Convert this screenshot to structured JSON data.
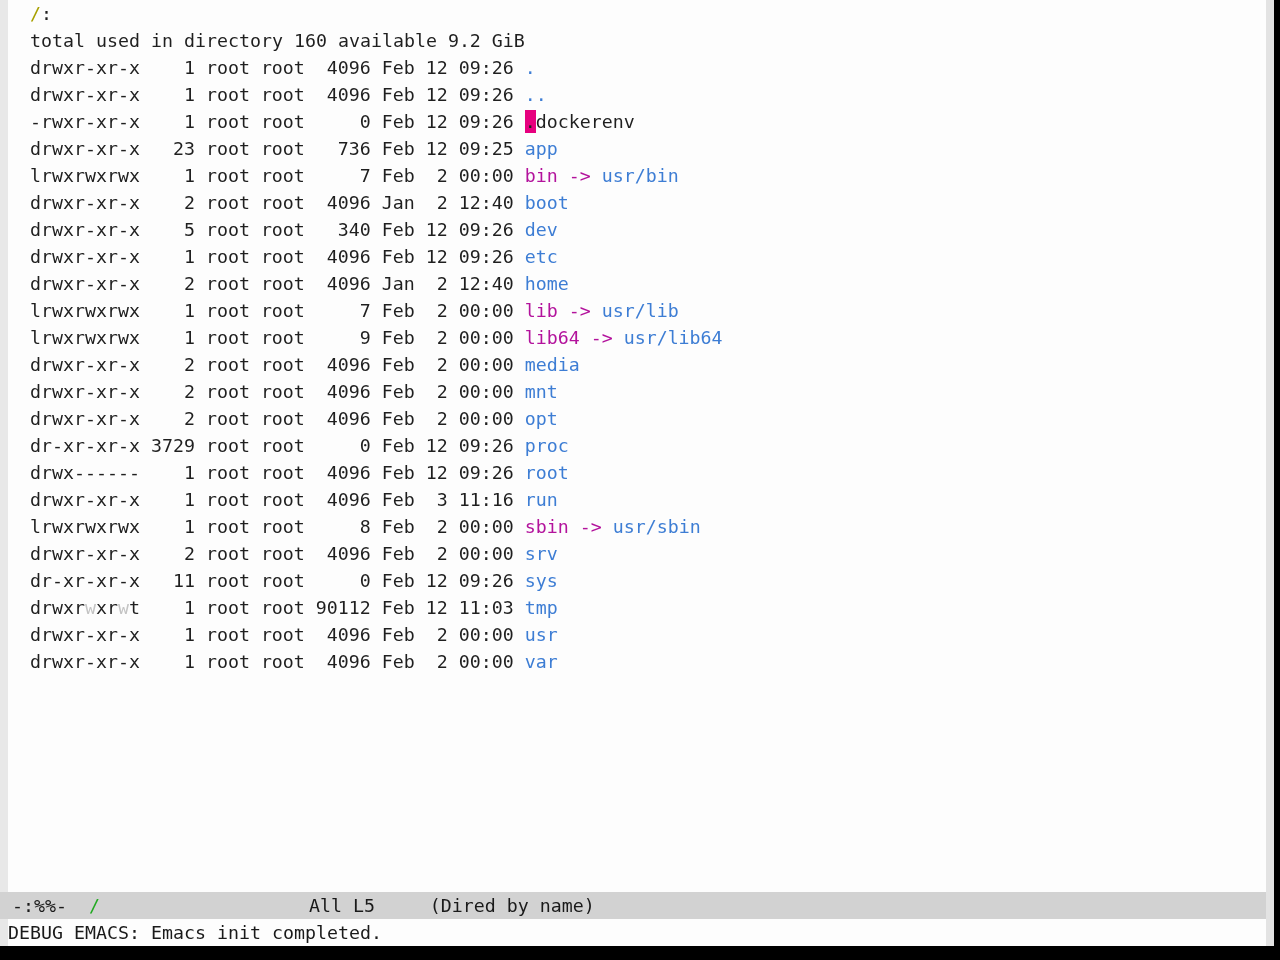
{
  "heading": {
    "path": "/",
    "suffix": ":"
  },
  "summary": "total used in directory 160 available 9.2 GiB",
  "entries": [
    {
      "permissions": [
        {
          "text": "drwxr-xr-x",
          "dim": false
        }
      ],
      "links": "1",
      "owner": "root",
      "group": "root",
      "size": "4096",
      "month": "Feb",
      "day": "12",
      "time": "09:26",
      "name": ".",
      "kind": "directory",
      "cursor": false
    },
    {
      "permissions": [
        {
          "text": "drwxr-xr-x",
          "dim": false
        }
      ],
      "links": "1",
      "owner": "root",
      "group": "root",
      "size": "4096",
      "month": "Feb",
      "day": "12",
      "time": "09:26",
      "name": "..",
      "kind": "directory",
      "cursor": false
    },
    {
      "permissions": [
        {
          "text": "-rwxr-xr-x",
          "dim": false
        }
      ],
      "links": "1",
      "owner": "root",
      "group": "root",
      "size": "0",
      "month": "Feb",
      "day": "12",
      "time": "09:26",
      "name": ".dockerenv",
      "kind": "file",
      "cursor": true
    },
    {
      "permissions": [
        {
          "text": "drwxr-xr-x",
          "dim": false
        }
      ],
      "links": "23",
      "owner": "root",
      "group": "root",
      "size": "736",
      "month": "Feb",
      "day": "12",
      "time": "09:25",
      "name": "app",
      "kind": "directory",
      "cursor": false
    },
    {
      "permissions": [
        {
          "text": "lrwxrwxrwx",
          "dim": false
        }
      ],
      "links": "1",
      "owner": "root",
      "group": "root",
      "size": "7",
      "month": "Feb",
      "day": "2",
      "time": "00:00",
      "name": "bin",
      "kind": "symlink",
      "arrow": "->",
      "target": "usr/bin",
      "cursor": false
    },
    {
      "permissions": [
        {
          "text": "drwxr-xr-x",
          "dim": false
        }
      ],
      "links": "2",
      "owner": "root",
      "group": "root",
      "size": "4096",
      "month": "Jan",
      "day": "2",
      "time": "12:40",
      "name": "boot",
      "kind": "directory",
      "cursor": false
    },
    {
      "permissions": [
        {
          "text": "drwxr-xr-x",
          "dim": false
        }
      ],
      "links": "5",
      "owner": "root",
      "group": "root",
      "size": "340",
      "month": "Feb",
      "day": "12",
      "time": "09:26",
      "name": "dev",
      "kind": "directory",
      "cursor": false
    },
    {
      "permissions": [
        {
          "text": "drwxr-xr-x",
          "dim": false
        }
      ],
      "links": "1",
      "owner": "root",
      "group": "root",
      "size": "4096",
      "month": "Feb",
      "day": "12",
      "time": "09:26",
      "name": "etc",
      "kind": "directory",
      "cursor": false
    },
    {
      "permissions": [
        {
          "text": "drwxr-xr-x",
          "dim": false
        }
      ],
      "links": "2",
      "owner": "root",
      "group": "root",
      "size": "4096",
      "month": "Jan",
      "day": "2",
      "time": "12:40",
      "name": "home",
      "kind": "directory",
      "cursor": false
    },
    {
      "permissions": [
        {
          "text": "lrwxrwxrwx",
          "dim": false
        }
      ],
      "links": "1",
      "owner": "root",
      "group": "root",
      "size": "7",
      "month": "Feb",
      "day": "2",
      "time": "00:00",
      "name": "lib",
      "kind": "symlink",
      "arrow": "->",
      "target": "usr/lib",
      "cursor": false
    },
    {
      "permissions": [
        {
          "text": "lrwxrwxrwx",
          "dim": false
        }
      ],
      "links": "1",
      "owner": "root",
      "group": "root",
      "size": "9",
      "month": "Feb",
      "day": "2",
      "time": "00:00",
      "name": "lib64",
      "kind": "symlink",
      "arrow": "->",
      "target": "usr/lib64",
      "cursor": false
    },
    {
      "permissions": [
        {
          "text": "drwxr-xr-x",
          "dim": false
        }
      ],
      "links": "2",
      "owner": "root",
      "group": "root",
      "size": "4096",
      "month": "Feb",
      "day": "2",
      "time": "00:00",
      "name": "media",
      "kind": "directory",
      "cursor": false
    },
    {
      "permissions": [
        {
          "text": "drwxr-xr-x",
          "dim": false
        }
      ],
      "links": "2",
      "owner": "root",
      "group": "root",
      "size": "4096",
      "month": "Feb",
      "day": "2",
      "time": "00:00",
      "name": "mnt",
      "kind": "directory",
      "cursor": false
    },
    {
      "permissions": [
        {
          "text": "drwxr-xr-x",
          "dim": false
        }
      ],
      "links": "2",
      "owner": "root",
      "group": "root",
      "size": "4096",
      "month": "Feb",
      "day": "2",
      "time": "00:00",
      "name": "opt",
      "kind": "directory",
      "cursor": false
    },
    {
      "permissions": [
        {
          "text": "dr-xr-xr-x",
          "dim": false
        }
      ],
      "links": "3729",
      "owner": "root",
      "group": "root",
      "size": "0",
      "month": "Feb",
      "day": "12",
      "time": "09:26",
      "name": "proc",
      "kind": "directory",
      "cursor": false
    },
    {
      "permissions": [
        {
          "text": "drwx------",
          "dim": false
        }
      ],
      "links": "1",
      "owner": "root",
      "group": "root",
      "size": "4096",
      "month": "Feb",
      "day": "12",
      "time": "09:26",
      "name": "root",
      "kind": "directory",
      "cursor": false
    },
    {
      "permissions": [
        {
          "text": "drwxr-xr-x",
          "dim": false
        }
      ],
      "links": "1",
      "owner": "root",
      "group": "root",
      "size": "4096",
      "month": "Feb",
      "day": "3",
      "time": "11:16",
      "name": "run",
      "kind": "directory",
      "cursor": false
    },
    {
      "permissions": [
        {
          "text": "lrwxrwxrwx",
          "dim": false
        }
      ],
      "links": "1",
      "owner": "root",
      "group": "root",
      "size": "8",
      "month": "Feb",
      "day": "2",
      "time": "00:00",
      "name": "sbin",
      "kind": "symlink",
      "arrow": "->",
      "target": "usr/sbin",
      "cursor": false
    },
    {
      "permissions": [
        {
          "text": "drwxr-xr-x",
          "dim": false
        }
      ],
      "links": "2",
      "owner": "root",
      "group": "root",
      "size": "4096",
      "month": "Feb",
      "day": "2",
      "time": "00:00",
      "name": "srv",
      "kind": "directory",
      "cursor": false
    },
    {
      "permissions": [
        {
          "text": "dr-xr-xr-x",
          "dim": false
        }
      ],
      "links": "11",
      "owner": "root",
      "group": "root",
      "size": "0",
      "month": "Feb",
      "day": "12",
      "time": "09:26",
      "name": "sys",
      "kind": "directory",
      "cursor": false
    },
    {
      "permissions": [
        {
          "text": "drwxr",
          "dim": false
        },
        {
          "text": "w",
          "dim": true
        },
        {
          "text": "xr",
          "dim": false
        },
        {
          "text": "w",
          "dim": true
        },
        {
          "text": "t",
          "dim": false
        }
      ],
      "links": "1",
      "owner": "root",
      "group": "root",
      "size": "90112",
      "month": "Feb",
      "day": "12",
      "time": "11:03",
      "name": "tmp",
      "kind": "directory",
      "cursor": false
    },
    {
      "permissions": [
        {
          "text": "drwxr-xr-x",
          "dim": false
        }
      ],
      "links": "1",
      "owner": "root",
      "group": "root",
      "size": "4096",
      "month": "Feb",
      "day": "2",
      "time": "00:00",
      "name": "usr",
      "kind": "directory",
      "cursor": false
    },
    {
      "permissions": [
        {
          "text": "drwxr-xr-x",
          "dim": false
        }
      ],
      "links": "1",
      "owner": "root",
      "group": "root",
      "size": "4096",
      "month": "Feb",
      "day": "2",
      "time": "00:00",
      "name": "var",
      "kind": "directory",
      "cursor": false
    }
  ],
  "mode_line": {
    "status": "-:%%-",
    "buffer_name": "/",
    "position": "All",
    "line": "L5",
    "mode": "(Dired by name)"
  },
  "echo_area": "DEBUG EMACS: Emacs init completed."
}
